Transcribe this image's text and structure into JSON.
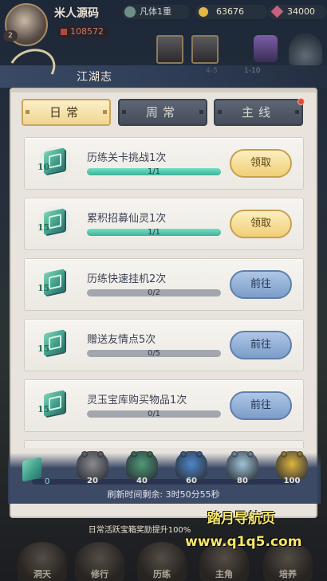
{
  "hud": {
    "player_name": "米人源码",
    "avatar_level": "2",
    "realm": "凡体1重",
    "coins": "63676",
    "gems": "34000",
    "power": "108572"
  },
  "stages": {
    "labels": [
      "4-5",
      "1-10"
    ]
  },
  "panel": {
    "title": "江湖志"
  },
  "tabs": [
    {
      "label": "日常",
      "active": true
    },
    {
      "label": "周常",
      "active": false
    },
    {
      "label": "主线",
      "active": false,
      "has_notification": true
    }
  ],
  "quests": [
    {
      "name": "历练关卡挑战1次",
      "reward_amount": "10",
      "progress_text": "1/1",
      "progress": 1.0,
      "button": "领取",
      "button_type": "claim"
    },
    {
      "name": "累积招募仙灵1次",
      "reward_amount": "15",
      "progress_text": "1/1",
      "progress": 1.0,
      "button": "领取",
      "button_type": "claim"
    },
    {
      "name": "历练快速挂机2次",
      "reward_amount": "15",
      "progress_text": "0/2",
      "progress": 0.0,
      "button": "前往",
      "button_type": "goto"
    },
    {
      "name": "赠送友情点5次",
      "reward_amount": "15",
      "progress_text": "0/5",
      "progress": 0.0,
      "button": "前往",
      "button_type": "goto"
    },
    {
      "name": "灵玉宝库购买物品1次",
      "reward_amount": "15",
      "progress_text": "0/1",
      "progress": 0.0,
      "button": "前往",
      "button_type": "goto"
    }
  ],
  "activity": {
    "current": "0",
    "progress": 0.0,
    "milestones": [
      {
        "value": "20",
        "color": "#8a8a8e"
      },
      {
        "value": "40",
        "color": "#4f9a78"
      },
      {
        "value": "60",
        "color": "#4d86c9"
      },
      {
        "value": "80",
        "color": "#9fc3d9"
      },
      {
        "value": "100",
        "color": "#e0b43c"
      }
    ],
    "refresh_label": "刷新时间剩余:",
    "refresh_time": "3时50分55秒"
  },
  "bonus_tip": "日常活跃宝箱奖励提升100%",
  "bottom_nav": [
    "洞天",
    "修行",
    "历练",
    "主角",
    "培养"
  ],
  "watermark": {
    "line1": "踏月导航页",
    "line2": "www.q1q5.com"
  },
  "colors": {
    "accent_gold": "#f0d592",
    "progress_green": "#3db29a",
    "goto_blue": "#7c9dc9"
  }
}
